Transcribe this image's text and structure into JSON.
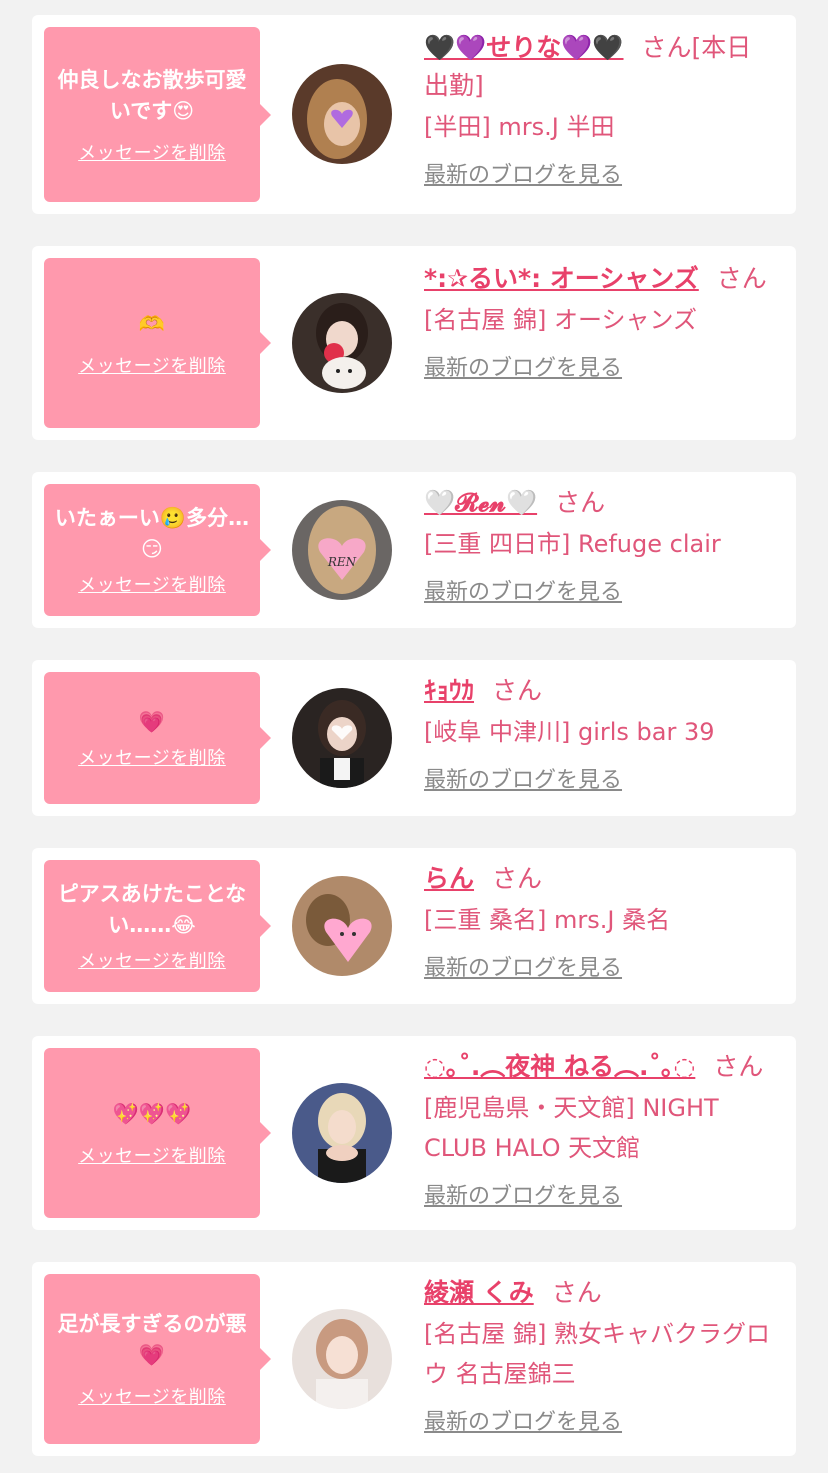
{
  "delete_label": "メッセージを削除",
  "blog_label": "最新のブログを見る",
  "honorific": "さん",
  "cards": [
    {
      "message": "仲良しなお散歩可愛いです😍",
      "name": "🖤💜せりな💜🖤",
      "suffix": "[本日出勤]",
      "shop": "[半田] mrs.J 半田"
    },
    {
      "message": "🫶",
      "name": "*:✰るい*: オーシャンズ",
      "suffix": "",
      "shop": "[名古屋 錦] オーシャンズ"
    },
    {
      "message": "いたぁーい🥲多分…😏",
      "name": "🤍𝓡𝓮𝓷🤍",
      "suffix": "",
      "shop": "[三重 四日市] Refuge clair"
    },
    {
      "message": "💗",
      "name": "ｷｮｳｶ",
      "suffix": "",
      "shop": "[岐阜 中津川] girls bar 39"
    },
    {
      "message": "ピアスあけたことない……😂",
      "name": "らん",
      "suffix": "",
      "shop": "[三重 桑名] mrs.J 桑名"
    },
    {
      "message": "💖💖💖",
      "name": "◌｡˚.︵夜神 ねる︵.˚｡◌",
      "suffix": "",
      "shop": "[鹿児島県・天文館] NIGHT CLUB HALO 天文館"
    },
    {
      "message": "足が長すぎるのが悪💗",
      "name": "綾瀬 くみ",
      "suffix": "",
      "shop": "[名古屋 錦] 熟女キャバクラグロウ 名古屋錦三"
    }
  ]
}
